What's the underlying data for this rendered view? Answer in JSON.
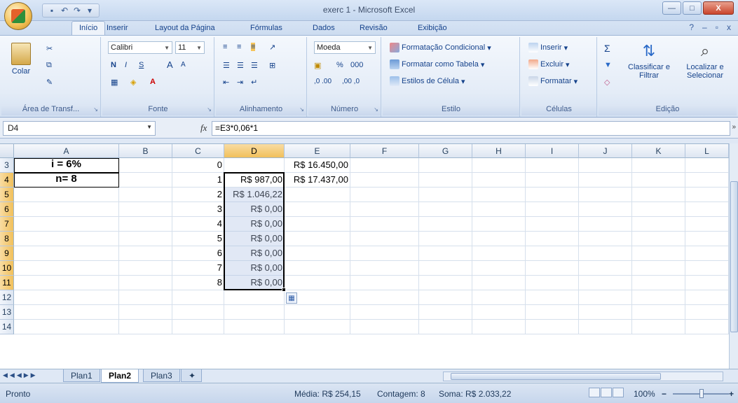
{
  "window": {
    "title": "exerc 1 - Microsoft Excel",
    "min": "—",
    "max": "□",
    "close": "X"
  },
  "qat": {
    "save": "▪",
    "undo": "↶",
    "redo": "↷",
    "more": "▾"
  },
  "tabs": [
    "Início",
    "Inserir",
    "Layout da Página",
    "Fórmulas",
    "Dados",
    "Revisão",
    "Exibição"
  ],
  "help": {
    "help": "?",
    "min": "–",
    "restore": "▫",
    "close": "x"
  },
  "ribbon": {
    "clipboard": {
      "paste": "Colar",
      "label": "Área de Transf..."
    },
    "font": {
      "name": "Calibri",
      "size": "11",
      "bold": "N",
      "italic": "I",
      "underline": "S",
      "grow": "A",
      "shrink": "A",
      "label": "Fonte"
    },
    "alignment": {
      "label": "Alinhamento"
    },
    "number": {
      "format": "Moeda",
      "percent": "%",
      "thousands": "000",
      "inc": ",0 .00",
      "dec": ",00 ,0",
      "label": "Número"
    },
    "styles": {
      "conditional": "Formatação Condicional",
      "table": "Formatar como Tabela",
      "cell": "Estilos de Célula",
      "label": "Estilo"
    },
    "cells": {
      "insert": "Inserir",
      "delete": "Excluir",
      "format": "Formatar",
      "label": "Células"
    },
    "editing": {
      "sum": "Σ",
      "sort": "Classificar e Filtrar",
      "find": "Localizar e Selecionar",
      "label": "Edição"
    }
  },
  "namebox": "D4",
  "formula": "=E3*0,06*1",
  "fx": "fx",
  "columns": [
    {
      "id": "A",
      "w": 150
    },
    {
      "id": "B",
      "w": 76
    },
    {
      "id": "C",
      "w": 74
    },
    {
      "id": "D",
      "w": 86
    },
    {
      "id": "E",
      "w": 94
    },
    {
      "id": "F",
      "w": 98
    },
    {
      "id": "G",
      "w": 76
    },
    {
      "id": "H",
      "w": 76
    },
    {
      "id": "I",
      "w": 76
    },
    {
      "id": "J",
      "w": 76
    },
    {
      "id": "K",
      "w": 76
    },
    {
      "id": "L",
      "w": 62
    }
  ],
  "rows": [
    "3",
    "4",
    "5",
    "6",
    "7",
    "8",
    "9",
    "10",
    "11",
    "12",
    "13",
    "14"
  ],
  "cells": {
    "A3": "i = 6%",
    "A4": "n= 8",
    "C3": "0",
    "C4": "1",
    "C5": "2",
    "C6": "3",
    "C7": "4",
    "C8": "5",
    "C9": "6",
    "C10": "7",
    "C11": "8",
    "D4": "R$ 987,00",
    "D5": "R$ 1.046,22",
    "D6": "R$ 0,00",
    "D7": "R$ 0,00",
    "D8": "R$ 0,00",
    "D9": "R$ 0,00",
    "D10": "R$ 0,00",
    "D11": "R$ 0,00",
    "E3": "R$ 16.450,00",
    "E4": "R$ 17.437,00"
  },
  "sheets": [
    "Plan1",
    "Plan2",
    "Plan3"
  ],
  "active_sheet": "Plan2",
  "status": {
    "ready": "Pronto",
    "average": "Média: R$ 254,15",
    "count": "Contagem: 8",
    "sum": "Soma: R$ 2.033,22",
    "zoom": "100%",
    "zoom_out": "−",
    "zoom_in": "+"
  }
}
